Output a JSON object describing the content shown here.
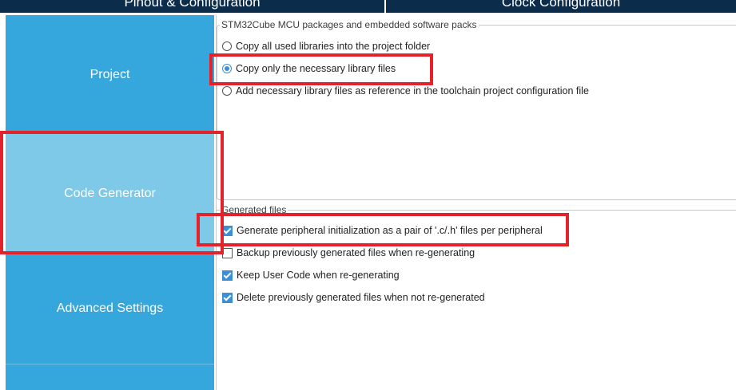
{
  "tabs": [
    {
      "label": "Pinout & Configuration"
    },
    {
      "label": "Clock Configuration"
    }
  ],
  "sidebar": {
    "items": [
      {
        "label": "Project",
        "selected": false
      },
      {
        "label": "Code Generator",
        "selected": true
      },
      {
        "label": "Advanced Settings",
        "selected": false
      },
      {
        "label": "",
        "selected": false
      }
    ]
  },
  "packs_group": {
    "title": "STM32Cube MCU packages and embedded software packs",
    "options": [
      {
        "label": "Copy all used libraries into the project folder",
        "selected": false
      },
      {
        "label": "Copy only the necessary library files",
        "selected": true
      },
      {
        "label": "Add necessary library files as reference in the toolchain project configuration file",
        "selected": false
      }
    ]
  },
  "generated_group": {
    "title": "Generated files",
    "options": [
      {
        "label": "Generate peripheral initialization as a pair of '.c/.h' files per peripheral",
        "checked": true
      },
      {
        "label": "Backup previously generated files when re-generating",
        "checked": false
      },
      {
        "label": "Keep User Code when re-generating",
        "checked": true
      },
      {
        "label": "Delete previously generated files when not re-generated",
        "checked": true
      }
    ]
  },
  "colors": {
    "tab_bar": "#0b2c4b",
    "sidebar": "#36a7dc",
    "sidebar_selected": "#7ec8e8",
    "accent": "#3b8fd6",
    "annotation": "#e4222c"
  }
}
